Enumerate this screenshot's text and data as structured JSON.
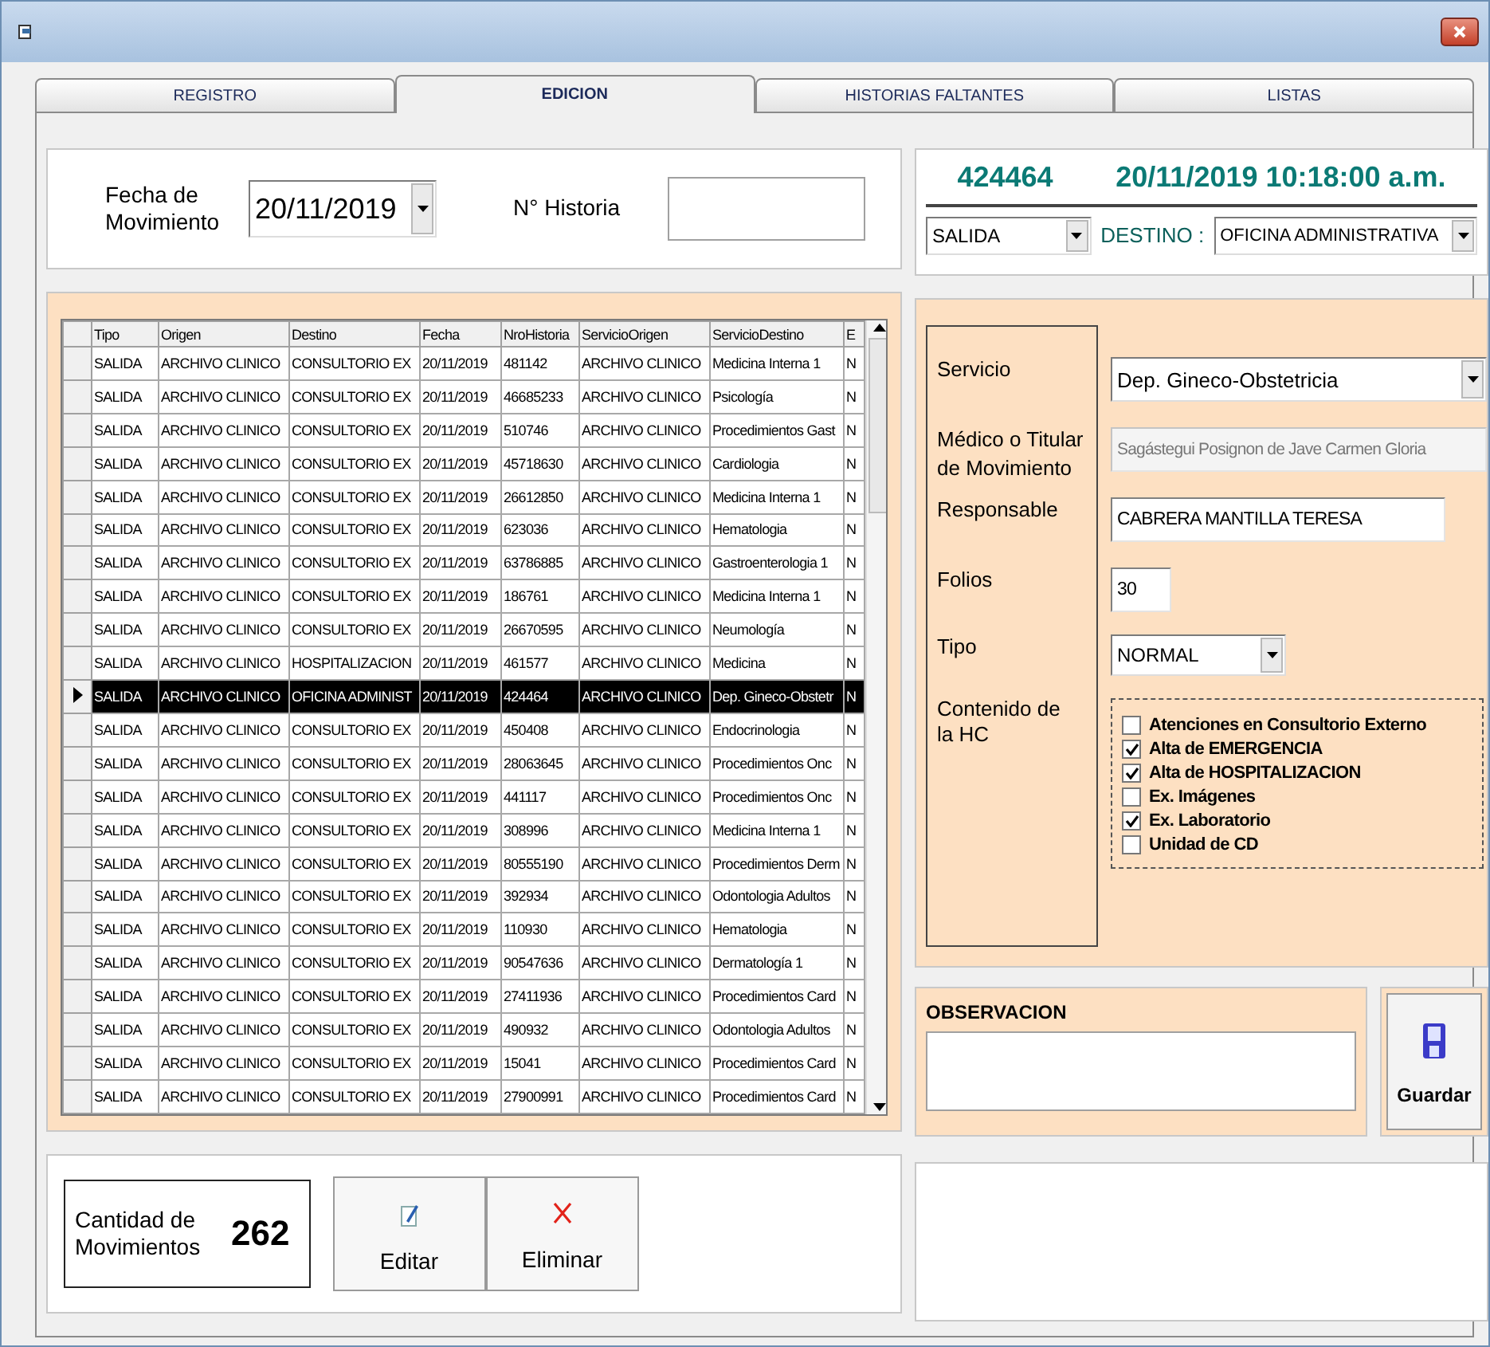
{
  "tabs": [
    {
      "label": "REGISTRO",
      "selected": false
    },
    {
      "label": "EDICION",
      "selected": true
    },
    {
      "label": "HISTORIAS FALTANTES",
      "selected": false
    },
    {
      "label": "LISTAS",
      "selected": false
    }
  ],
  "filter": {
    "date_label": "Fecha de Movimiento",
    "date_value": "20/11/2019",
    "historia_label": "N° Historia"
  },
  "grid": {
    "columns": [
      "Tipo",
      "Origen",
      "Destino",
      "Fecha",
      "NroHistoria",
      "ServicioOrigen",
      "ServicioDestino",
      "E"
    ],
    "rows": [
      {
        "selected": false,
        "cells": [
          "SALIDA",
          "ARCHIVO CLINICO",
          "CONSULTORIO EX",
          "20/11/2019",
          "481142",
          "ARCHIVO CLINICO",
          "Medicina Interna 1",
          "N"
        ]
      },
      {
        "selected": false,
        "cells": [
          "SALIDA",
          "ARCHIVO CLINICO",
          "CONSULTORIO EX",
          "20/11/2019",
          "46685233",
          "ARCHIVO CLINICO",
          "Psicología",
          "N"
        ]
      },
      {
        "selected": false,
        "cells": [
          "SALIDA",
          "ARCHIVO CLINICO",
          "CONSULTORIO EX",
          "20/11/2019",
          "510746",
          "ARCHIVO CLINICO",
          "Procedimientos Gast",
          "N"
        ]
      },
      {
        "selected": false,
        "cells": [
          "SALIDA",
          "ARCHIVO CLINICO",
          "CONSULTORIO EX",
          "20/11/2019",
          "45718630",
          "ARCHIVO CLINICO",
          "Cardiologia",
          "N"
        ]
      },
      {
        "selected": false,
        "cells": [
          "SALIDA",
          "ARCHIVO CLINICO",
          "CONSULTORIO EX",
          "20/11/2019",
          "26612850",
          "ARCHIVO CLINICO",
          "Medicina Interna 1",
          "N"
        ]
      },
      {
        "selected": false,
        "cells": [
          "SALIDA",
          "ARCHIVO CLINICO",
          "CONSULTORIO EX",
          "20/11/2019",
          "623036",
          "ARCHIVO CLINICO",
          "Hematologia",
          "N"
        ]
      },
      {
        "selected": false,
        "cells": [
          "SALIDA",
          "ARCHIVO CLINICO",
          "CONSULTORIO EX",
          "20/11/2019",
          "63786885",
          "ARCHIVO CLINICO",
          "Gastroenterologia 1",
          "N"
        ]
      },
      {
        "selected": false,
        "cells": [
          "SALIDA",
          "ARCHIVO CLINICO",
          "CONSULTORIO EX",
          "20/11/2019",
          "186761",
          "ARCHIVO CLINICO",
          "Medicina Interna 1",
          "N"
        ]
      },
      {
        "selected": false,
        "cells": [
          "SALIDA",
          "ARCHIVO CLINICO",
          "CONSULTORIO EX",
          "20/11/2019",
          "26670595",
          "ARCHIVO CLINICO",
          "Neumología",
          "N"
        ]
      },
      {
        "selected": false,
        "cells": [
          "SALIDA",
          "ARCHIVO CLINICO",
          "HOSPITALIZACION",
          "20/11/2019",
          "461577",
          "ARCHIVO CLINICO",
          "Medicina",
          "N"
        ]
      },
      {
        "selected": true,
        "cells": [
          "SALIDA",
          "ARCHIVO CLINICO",
          "OFICINA ADMINIST",
          "20/11/2019",
          "424464",
          "ARCHIVO CLINICO",
          "Dep. Gineco-Obstetr",
          "N"
        ]
      },
      {
        "selected": false,
        "cells": [
          "SALIDA",
          "ARCHIVO CLINICO",
          "CONSULTORIO EX",
          "20/11/2019",
          "450408",
          "ARCHIVO CLINICO",
          "Endocrinologia",
          "N"
        ]
      },
      {
        "selected": false,
        "cells": [
          "SALIDA",
          "ARCHIVO CLINICO",
          "CONSULTORIO EX",
          "20/11/2019",
          "28063645",
          "ARCHIVO CLINICO",
          "Procedimientos Onc",
          "N"
        ]
      },
      {
        "selected": false,
        "cells": [
          "SALIDA",
          "ARCHIVO CLINICO",
          "CONSULTORIO EX",
          "20/11/2019",
          "441117",
          "ARCHIVO CLINICO",
          "Procedimientos Onc",
          "N"
        ]
      },
      {
        "selected": false,
        "cells": [
          "SALIDA",
          "ARCHIVO CLINICO",
          "CONSULTORIO EX",
          "20/11/2019",
          "308996",
          "ARCHIVO CLINICO",
          "Medicina Interna 1",
          "N"
        ]
      },
      {
        "selected": false,
        "cells": [
          "SALIDA",
          "ARCHIVO CLINICO",
          "CONSULTORIO EX",
          "20/11/2019",
          "80555190",
          "ARCHIVO CLINICO",
          "Procedimientos Derm",
          "N"
        ]
      },
      {
        "selected": false,
        "cells": [
          "SALIDA",
          "ARCHIVO CLINICO",
          "CONSULTORIO EX",
          "20/11/2019",
          "392934",
          "ARCHIVO CLINICO",
          "Odontologia Adultos",
          "N"
        ]
      },
      {
        "selected": false,
        "cells": [
          "SALIDA",
          "ARCHIVO CLINICO",
          "CONSULTORIO EX",
          "20/11/2019",
          "110930",
          "ARCHIVO CLINICO",
          "Hematologia",
          "N"
        ]
      },
      {
        "selected": false,
        "cells": [
          "SALIDA",
          "ARCHIVO CLINICO",
          "CONSULTORIO EX",
          "20/11/2019",
          "90547636",
          "ARCHIVO CLINICO",
          "Dermatología 1",
          "N"
        ]
      },
      {
        "selected": false,
        "cells": [
          "SALIDA",
          "ARCHIVO CLINICO",
          "CONSULTORIO EX",
          "20/11/2019",
          "27411936",
          "ARCHIVO CLINICO",
          "Procedimientos Card",
          "N"
        ]
      },
      {
        "selected": false,
        "cells": [
          "SALIDA",
          "ARCHIVO CLINICO",
          "CONSULTORIO EX",
          "20/11/2019",
          "490932",
          "ARCHIVO CLINICO",
          "Odontologia Adultos",
          "N"
        ]
      },
      {
        "selected": false,
        "cells": [
          "SALIDA",
          "ARCHIVO CLINICO",
          "CONSULTORIO EX",
          "20/11/2019",
          "15041",
          "ARCHIVO CLINICO",
          "Procedimientos Card",
          "N"
        ]
      },
      {
        "selected": false,
        "cells": [
          "SALIDA",
          "ARCHIVO CLINICO",
          "CONSULTORIO EX",
          "20/11/2019",
          "27900991",
          "ARCHIVO CLINICO",
          "Procedimientos Card",
          "N"
        ]
      }
    ]
  },
  "summary": {
    "label": "Cantidad de Movimientos",
    "count": "262"
  },
  "actions": [
    {
      "kind": "edit",
      "label": "Editar"
    },
    {
      "kind": "delete",
      "label": "Eliminar"
    }
  ],
  "record": {
    "number": "424464",
    "datetime": "20/11/2019 10:18:00 a.m.",
    "movement": "SALIDA",
    "destino_label": "DESTINO :",
    "destino": "OFICINA ADMINISTRATIVA"
  },
  "form": {
    "fields": [
      {
        "kind": "select",
        "label": "Servicio",
        "value": "Dep. Gineco-Obstetricia"
      },
      {
        "kind": "text",
        "label": "Médico o Titular de Movimiento",
        "value": "Sagástegui Posignon de Jave Carmen Gloria",
        "disabled": true
      },
      {
        "kind": "text",
        "label": "Responsable",
        "value": "CABRERA MANTILLA TERESA"
      },
      {
        "kind": "short",
        "label": "Folios",
        "value": "30"
      },
      {
        "kind": "smallselect",
        "label": "Tipo",
        "value": "NORMAL"
      }
    ],
    "contents_label": "Contenido de la HC",
    "contents": [
      {
        "label": "Atenciones en Consultorio Externo",
        "checked": false
      },
      {
        "label": "Alta de EMERGENCIA",
        "checked": true
      },
      {
        "label": "Alta de HOSPITALIZACION",
        "checked": true
      },
      {
        "label": "Ex. Imágenes",
        "checked": false
      },
      {
        "label": "Ex. Laboratorio",
        "checked": true
      },
      {
        "label": "Unidad de CD",
        "checked": false
      }
    ]
  },
  "observacion": {
    "label": "OBSERVACION"
  },
  "save": {
    "label": "Guardar"
  }
}
